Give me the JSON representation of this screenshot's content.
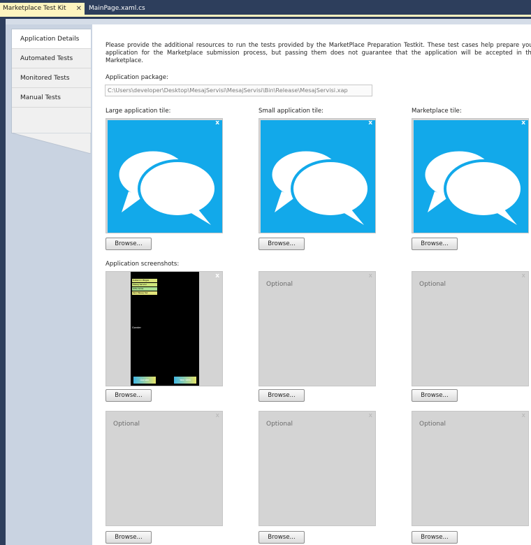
{
  "tabs": [
    {
      "label": "Marketplace Test Kit",
      "close": "✕",
      "active": true
    },
    {
      "label": "MainPage.xaml.cs",
      "active": false
    }
  ],
  "sidebar": {
    "items": [
      {
        "label": "Application Details",
        "selected": true
      },
      {
        "label": "Automated Tests",
        "selected": false
      },
      {
        "label": "Monitored Tests",
        "selected": false
      },
      {
        "label": "Manual Tests",
        "selected": false
      }
    ]
  },
  "main": {
    "intro": "Please provide the additional resources to run the tests provided by the MarketPlace Preparation Testkit. These test cases help prepare your application for the Marketplace submission process, but passing them does not guarantee that the application will be accepted in the Marketplace.",
    "package_label": "Application package:",
    "package_value": "C:\\Users\\developer\\Desktop\\MesajServisi\\MesajServisi\\Bin\\Release\\MesajServisi.xap",
    "tiles": {
      "large_label": "Large application tile:",
      "small_label": "Small application tile:",
      "marketplace_label": "Marketplace tile:",
      "close_glyph": "x"
    },
    "screenshots_label": "Application screenshots:",
    "optional_text": "Optional",
    "browse_label": "Browse...",
    "phone": {
      "bar1": "Kullanici: Bilgisi",
      "bar2": "Mesaj Servisi",
      "bar3": "Sifre Girisi",
      "bar4": "Yeni Mesaj Yaz",
      "middle": "Gonder",
      "btn_left": "Gonder",
      "btn_right": "Yeni SMS"
    }
  },
  "colors": {
    "accent_tab": "#fdf4bf",
    "frame": "#2d3e5c",
    "tile_blue": "#12a9ea"
  }
}
